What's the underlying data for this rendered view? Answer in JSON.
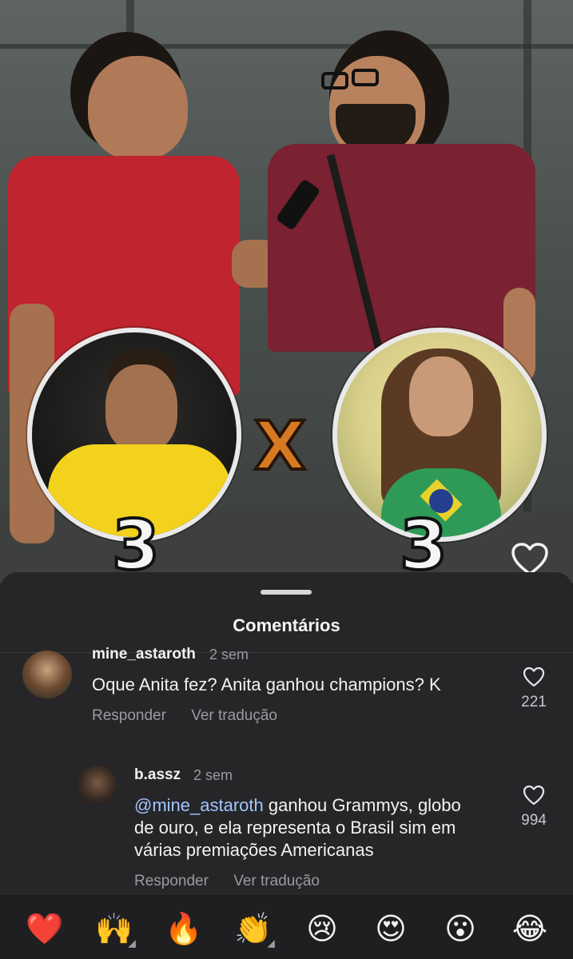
{
  "video": {
    "score_left": "3",
    "score_right": "3",
    "versus": "X"
  },
  "sheet": {
    "title": "Comentários"
  },
  "comments": [
    {
      "user": "mine_astaroth",
      "time": "2 sem",
      "text": "Oque Anita fez? Anita ganhou champions? K",
      "reply_label": "Responder",
      "translate_label": "Ver tradução",
      "likes": "221"
    },
    {
      "user": "b.assz",
      "time": "2 sem",
      "mention": "@mine_astaroth",
      "text_line1_rest": " ganhou Grammys, globo",
      "text_line2": "de ouro, e ela representa o Brasil sim em",
      "text_line3": "várias premiações Americanas",
      "reply_label": "Responder",
      "translate_label": "Ver tradução",
      "likes": "994"
    }
  ],
  "reactions": [
    {
      "name": "red-heart",
      "glyph": "❤️",
      "has_more": false
    },
    {
      "name": "raising-hands",
      "glyph": "🙌",
      "has_more": true
    },
    {
      "name": "fire",
      "glyph": "🔥",
      "has_more": false
    },
    {
      "name": "clapping-hands",
      "glyph": "👏",
      "has_more": true
    },
    {
      "name": "crying-face",
      "glyph": "😢",
      "has_more": false
    },
    {
      "name": "heart-eyes",
      "glyph": "😍",
      "has_more": false
    },
    {
      "name": "surprised-face",
      "glyph": "😮",
      "has_more": false
    },
    {
      "name": "tears-of-joy",
      "glyph": "😂",
      "has_more": false
    }
  ],
  "colors": {
    "sheet_bg": "#262628",
    "mention": "#a3c5ff",
    "secondary_text": "#9b9b9f",
    "versus_orange": "#d67a22",
    "shirt_red": "#c0242e",
    "shirt_maroon": "#7a2232",
    "jersey_yellow": "#f2d21c"
  }
}
